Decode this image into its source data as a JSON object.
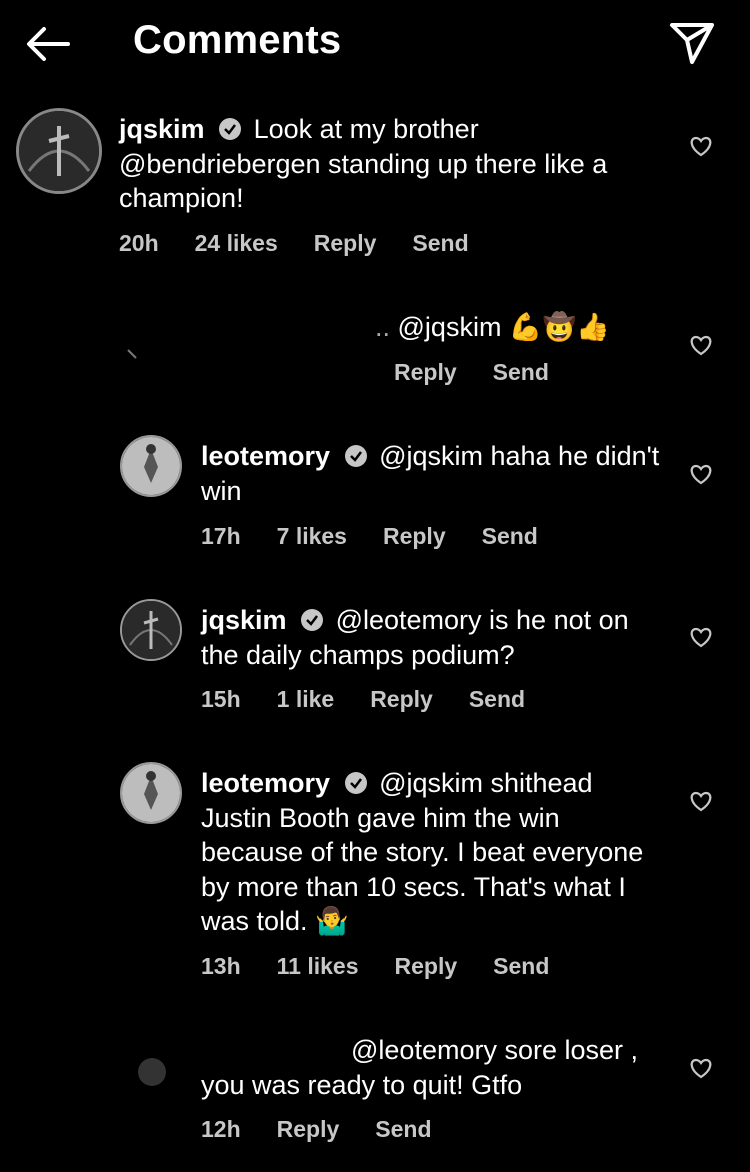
{
  "header": {
    "title": "Comments",
    "back_icon": "arrow-left-icon",
    "share_icon": "paper-plane-icon"
  },
  "comments": [
    {
      "user": "jqskim",
      "verified": true,
      "text": "Look at my brother @bendriebergen standing up there like a champion!",
      "time": "20h",
      "likes": "24 likes",
      "reply": "Reply",
      "send": "Send"
    },
    {
      "user": "",
      "verified": false,
      "text": "@jqskim 💪🤠👍",
      "time": "",
      "likes": "",
      "reply": "Reply",
      "send": "Send"
    },
    {
      "user": "leotemory",
      "verified": true,
      "text": "@jqskim haha he didn't win",
      "time": "17h",
      "likes": "7 likes",
      "reply": "Reply",
      "send": "Send"
    },
    {
      "user": "jqskim",
      "verified": true,
      "text": "@leotemory is he not on the daily champs podium?",
      "time": "15h",
      "likes": "1 like",
      "reply": "Reply",
      "send": "Send"
    },
    {
      "user": "leotemory",
      "verified": true,
      "text": "@jqskim shithead Justin Booth gave him the win because of the story. I beat everyone by more than 10 secs. That's what I was told. 🤷‍♂️",
      "time": "13h",
      "likes": "11 likes",
      "reply": "Reply",
      "send": "Send"
    },
    {
      "user": "",
      "verified": false,
      "text": "@leotemory sore loser , you was ready to quit! Gtfo",
      "time": "12h",
      "likes": "",
      "reply": "Reply",
      "send": "Send"
    }
  ],
  "colors": {
    "background": "#000000",
    "meta": "#c7c7c7",
    "text": "#ffffff"
  }
}
